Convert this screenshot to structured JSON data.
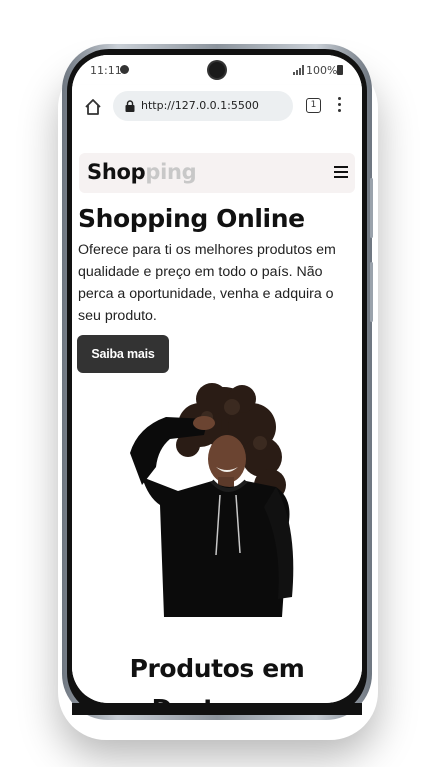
{
  "status_bar": {
    "time": "11:11",
    "battery": "100%"
  },
  "browser": {
    "url": "http://127.0.0.1:5500",
    "tab_count": "1"
  },
  "navbar": {
    "logo_part1": "Shop",
    "logo_part2": "ping",
    "logo_part2_color": "#c8c8c8"
  },
  "hero": {
    "title": "Shopping Online",
    "text": "Oferece para ti os melhores produtos em qualidade e preço em todo o país. Não perca a oportunidade, venha e adquira o seu produto.",
    "button": "Saiba mais"
  },
  "section": {
    "title": "Produtos em Destaque"
  },
  "colors": {
    "button_bg": "#333333",
    "navbar_bg": "#f6f2f2"
  }
}
